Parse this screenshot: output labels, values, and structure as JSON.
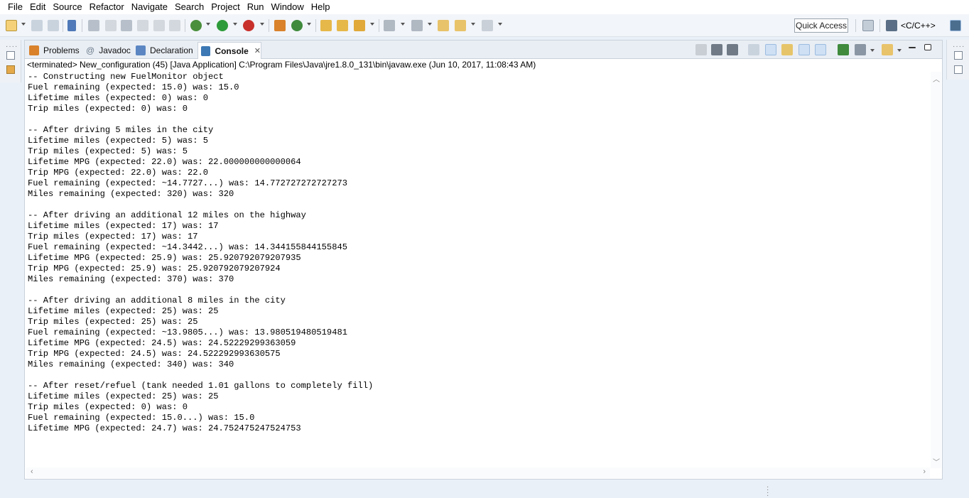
{
  "menu": [
    "File",
    "Edit",
    "Source",
    "Refactor",
    "Navigate",
    "Search",
    "Project",
    "Run",
    "Window",
    "Help"
  ],
  "toolbar": {
    "quick_access": "Quick Access",
    "perspective": "<C/C++>"
  },
  "tabs": [
    {
      "label": "Problems",
      "icon": "problems-icon",
      "color": "#d9822b"
    },
    {
      "label": "Javadoc",
      "icon": "javadoc-icon",
      "color": "#6a7a8a"
    },
    {
      "label": "Declaration",
      "icon": "declaration-icon",
      "color": "#5b86c2"
    },
    {
      "label": "Console",
      "icon": "console-icon",
      "color": "#3c78b4"
    }
  ],
  "console": {
    "header": "<terminated> New_configuration (45) [Java Application] C:\\Program Files\\Java\\jre1.8.0_131\\bin\\javaw.exe (Jun 10, 2017, 11:08:43 AM)",
    "lines": [
      "-- Constructing new FuelMonitor object",
      "Fuel remaining (expected: 15.0) was: 15.0",
      "Lifetime miles (expected: 0) was: 0",
      "Trip miles (expected: 0) was: 0",
      "",
      "-- After driving 5 miles in the city",
      "Lifetime miles (expected: 5) was: 5",
      "Trip miles (expected: 5) was: 5",
      "Lifetime MPG (expected: 22.0) was: 22.000000000000064",
      "Trip MPG (expected: 22.0) was: 22.0",
      "Fuel remaining (expected: ~14.7727...) was: 14.772727272727273",
      "Miles remaining (expected: 320) was: 320",
      "",
      "-- After driving an additional 12 miles on the highway",
      "Lifetime miles (expected: 17) was: 17",
      "Trip miles (expected: 17) was: 17",
      "Fuel remaining (expected: ~14.3442...) was: 14.344155844155845",
      "Lifetime MPG (expected: 25.9) was: 25.920792079207935",
      "Trip MPG (expected: 25.9) was: 25.920792079207924",
      "Miles remaining (expected: 370) was: 370",
      "",
      "-- After driving an additional 8 miles in the city",
      "Lifetime miles (expected: 25) was: 25",
      "Trip miles (expected: 25) was: 25",
      "Fuel remaining (expected: ~13.9805...) was: 13.980519480519481",
      "Lifetime MPG (expected: 24.5) was: 24.52229299363059",
      "Trip MPG (expected: 24.5) was: 24.522292993630575",
      "Miles remaining (expected: 340) was: 340",
      "",
      "-- After reset/refuel (tank needed 1.01 gallons to completely fill)",
      "Lifetime miles (expected: 25) was: 25",
      "Trip miles (expected: 0) was: 0",
      "Fuel remaining (expected: 15.0...) was: 15.0",
      "Lifetime MPG (expected: 24.7) was: 24.752475247524753"
    ]
  },
  "colors": {
    "accent": "#3c78b4",
    "run_green": "#2e9b3a",
    "debug_green": "#4a8f3c",
    "error_red": "#c8302c",
    "package_orange": "#d9822b"
  }
}
